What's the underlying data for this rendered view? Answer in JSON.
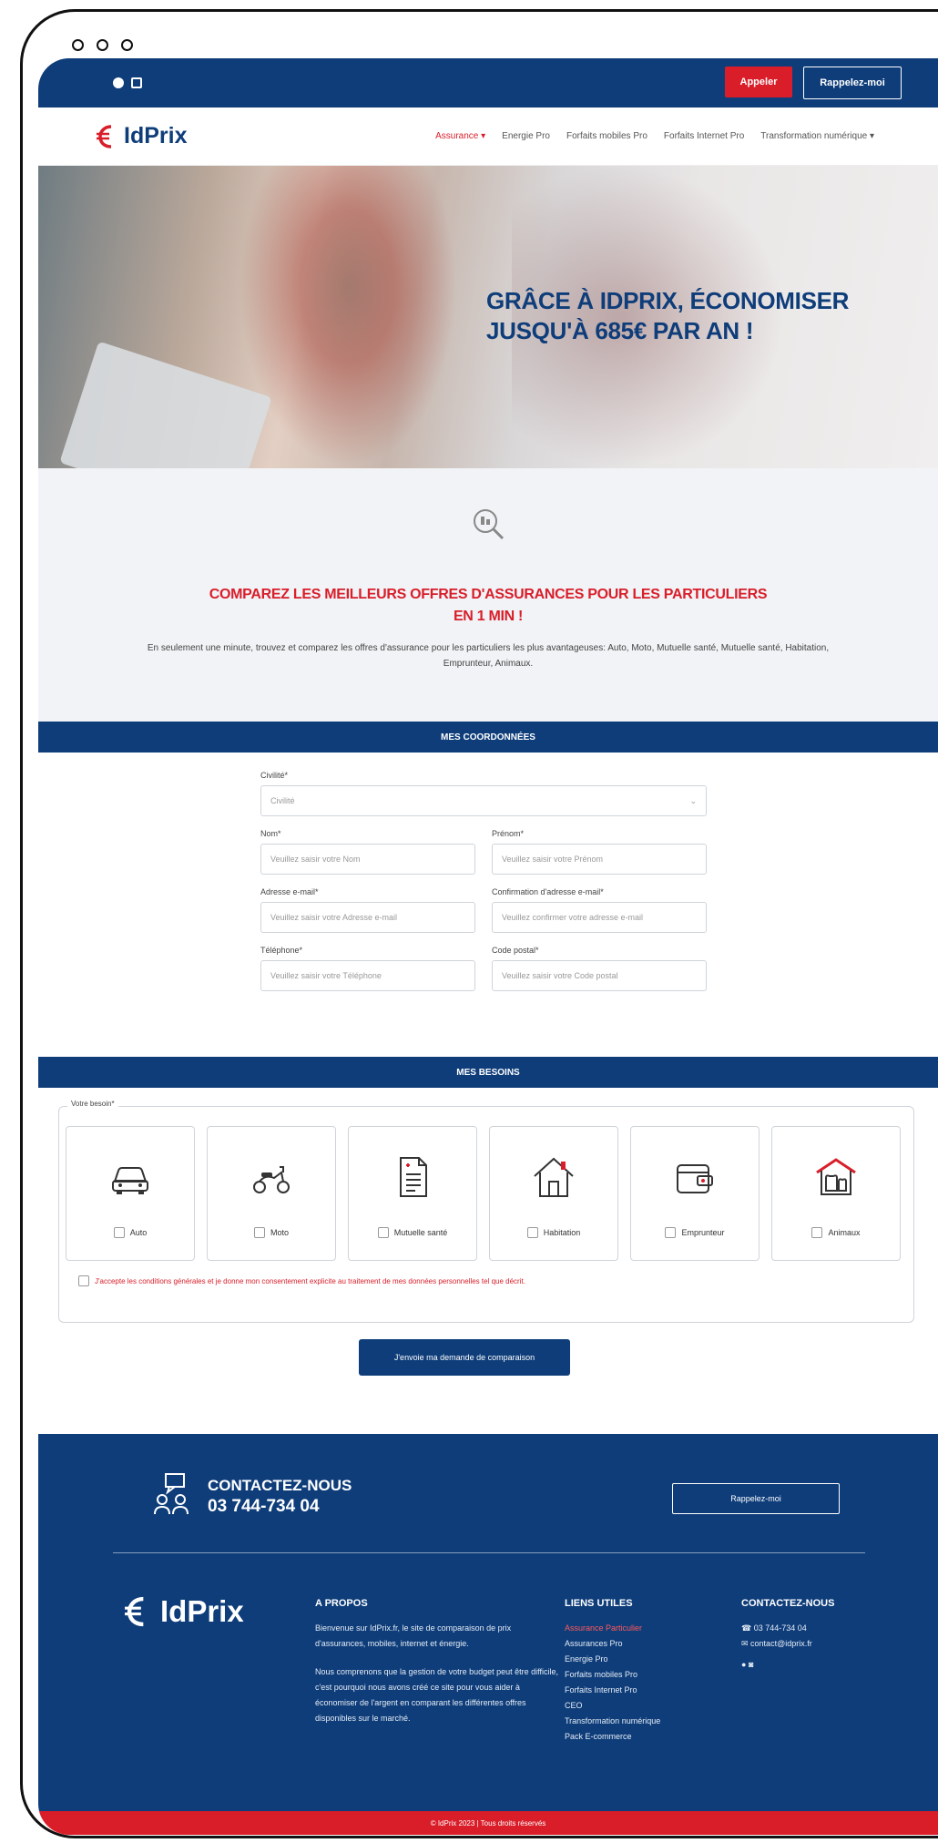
{
  "topbar": {
    "call_label": "Appeler",
    "callback_label": "Rappelez-moi"
  },
  "nav": {
    "logo": "IdPrix",
    "links": [
      "Assurance",
      "Energie Pro",
      "Forfaits mobiles Pro",
      "Forfaits Internet Pro",
      "Transformation numérique"
    ]
  },
  "hero": {
    "title": "GRÂCE À IDPRIX, ÉCONOMISER JUSQU'À 685€ PAR AN !"
  },
  "compare": {
    "title_line1": "COMPAREZ LES MEILLEURS OFFRES D'ASSURANCES POUR LES PARTICULIERS",
    "title_line2": "EN 1 MIN !",
    "description": "En seulement une minute, trouvez et comparez les offres d'assurance pour les particuliers les plus avantageuses: Auto, Moto, Mutuelle santé, Mutuelle santé, Habitation, Emprunteur, Animaux."
  },
  "coordonnees": {
    "band_title": "MES COORDONNÉES",
    "civilite_label": "Civilité*",
    "civilite_value": "Civilité",
    "nom_label": "Nom*",
    "nom_placeholder": "Veuillez saisir votre Nom",
    "prenom_label": "Prénom*",
    "prenom_placeholder": "Veuillez saisir votre Prénom",
    "email_label": "Adresse e-mail*",
    "email_placeholder": "Veuillez saisir votre Adresse e-mail",
    "email_confirm_label": "Confirmation d'adresse e-mail*",
    "email_confirm_placeholder": "Veuillez confirmer votre adresse e-mail",
    "phone_label": "Téléphone*",
    "phone_placeholder": "Veuillez saisir votre Téléphone",
    "cp_label": "Code postal*",
    "cp_placeholder": "Veuillez saisir votre Code postal"
  },
  "besoins": {
    "band_title": "MES BESOINS",
    "legend": "Votre besoin*",
    "options": [
      {
        "label": "Auto",
        "icon": "car-icon"
      },
      {
        "label": "Moto",
        "icon": "scooter-icon"
      },
      {
        "label": "Mutuelle santé",
        "icon": "document-icon"
      },
      {
        "label": "Habitation",
        "icon": "house-icon"
      },
      {
        "label": "Emprunteur",
        "icon": "wallet-icon"
      },
      {
        "label": "Animaux",
        "icon": "pet-house-icon"
      }
    ],
    "accept_text": "J'accepte les conditions générales et je donne mon consentement explicite au traitement de mes données personnelles tel que décrit.",
    "submit_label": "J'envoie ma demande de comparaison"
  },
  "footer": {
    "contact_title": "CONTACTEZ-NOUS",
    "contact_phone": "03 744-734 04",
    "callback_label": "Rappelez-moi",
    "logo": "IdPrix",
    "about_title": "A PROPOS",
    "about_p1": "Bienvenue sur IdPrix.fr, le site de comparaison de prix d'assurances, mobiles, internet et énergie.",
    "about_p2": "Nous comprenons que la gestion de votre budget peut être difficile, c'est pourquoi nous avons créé ce site pour vous aider à économiser de l'argent en comparant les différentes offres disponibles sur le marché.",
    "links_title": "LIENS UTILES",
    "links": [
      "Assurance Particulier",
      "Assurances Pro",
      "Energie Pro",
      "Forfaits mobiles Pro",
      "Forfaits Internet Pro",
      "CEO",
      "Transformation numérique",
      "Pack E-commerce"
    ],
    "contact_col_title": "CONTACTEZ-NOUS",
    "contact_col_phone": "03 744-734 04",
    "contact_col_email": "contact@idprix.fr",
    "copyright": "© IdPrix 2023 | Tous droits réservés"
  },
  "colors": {
    "brand_blue": "#0e3d7a",
    "brand_red": "#d91e2a"
  }
}
